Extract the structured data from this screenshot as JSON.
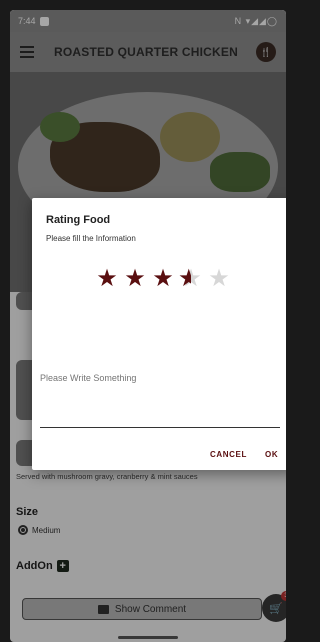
{
  "status_bar": {
    "time": "7:44",
    "icons": "N ▾◢◢◯"
  },
  "app_bar": {
    "title": "ROASTED QUARTER CHICKEN"
  },
  "content": {
    "description": "Served with mushroom gravy, cranberry & mint sauces",
    "size_label": "Size",
    "size_option": "Medium",
    "addon_label": "AddOn",
    "show_comment_label": "Show Comment",
    "cart_count": "3"
  },
  "dialog": {
    "title": "Rating Food",
    "subtitle": "Please fill the Information",
    "rating": 3.5,
    "max_rating": 5,
    "comment_placeholder": "Please Write Something",
    "cancel_label": "CANCEL",
    "ok_label": "OK",
    "accent_color": "#5a0f10"
  }
}
